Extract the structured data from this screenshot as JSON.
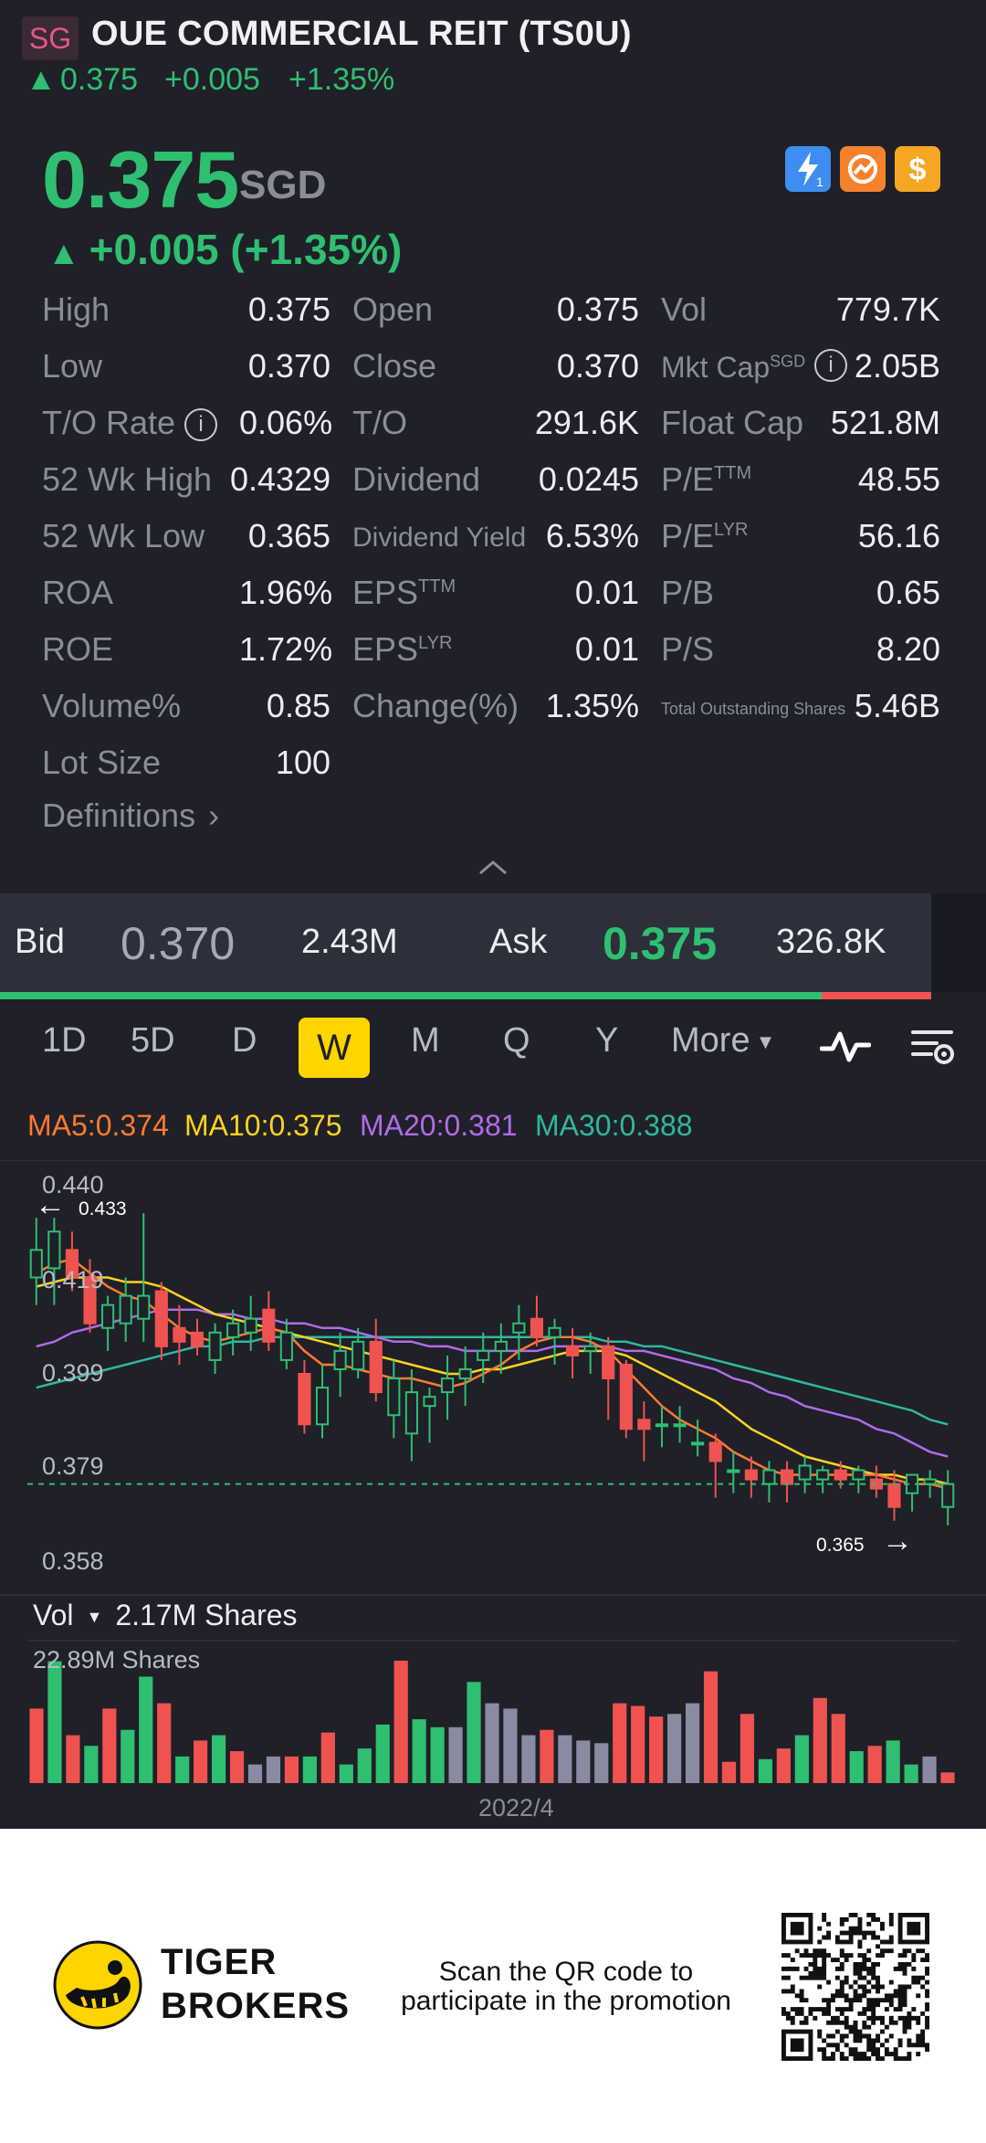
{
  "header": {
    "market_tag": "SG",
    "title": "OUE COMMERCIAL REIT (TS0U)",
    "last": "0.375",
    "change": "+0.005",
    "change_pct": "+1.35%"
  },
  "quote": {
    "price": "0.375",
    "currency": "SGD",
    "change_line": "+0.005 (+1.35%)"
  },
  "badges": [
    "lightning-badge-icon",
    "options-badge-icon",
    "dollar-badge-icon"
  ],
  "stats": {
    "col1": [
      {
        "label": "High",
        "value": "0.375"
      },
      {
        "label": "Low",
        "value": "0.370"
      },
      {
        "label": "T/O Rate",
        "value": "0.06%"
      },
      {
        "label": "52 Wk High",
        "value": "0.4329"
      },
      {
        "label": "52 Wk Low",
        "value": "0.365"
      },
      {
        "label": "ROA",
        "value": "1.96%"
      },
      {
        "label": "ROE",
        "value": "1.72%"
      },
      {
        "label": "Volume%",
        "value": "0.85"
      },
      {
        "label": "Lot Size",
        "value": "100"
      }
    ],
    "col2": [
      {
        "label": "Open",
        "value": "0.375"
      },
      {
        "label": "Close",
        "value": "0.370"
      },
      {
        "label": "T/O",
        "value": "291.6K"
      },
      {
        "label": "Dividend",
        "value": "0.0245"
      },
      {
        "label": "Dividend Yield",
        "value": "6.53%"
      },
      {
        "label": "EPS",
        "sup": "TTM",
        "value": "0.01"
      },
      {
        "label": "EPS",
        "sup": "LYR",
        "value": "0.01"
      },
      {
        "label": "Change(%)",
        "value": "1.35%"
      }
    ],
    "col3": [
      {
        "label": "Vol",
        "value": "779.7K"
      },
      {
        "label": "Mkt Cap",
        "sup": "SGD",
        "value": "2.05B"
      },
      {
        "label": "Float Cap",
        "value": "521.8M"
      },
      {
        "label": "P/E",
        "sup": "TTM",
        "value": "48.55"
      },
      {
        "label": "P/E",
        "sup": "LYR",
        "value": "56.16"
      },
      {
        "label": "P/B",
        "value": "0.65"
      },
      {
        "label": "P/S",
        "value": "8.20"
      },
      {
        "label": "Total Outstanding Shares",
        "value": "5.46B"
      }
    ],
    "definitions": "Definitions"
  },
  "orderbook": {
    "bid_label": "Bid",
    "bid_price": "0.370",
    "bid_size": "2.43M",
    "ask_label": "Ask",
    "ask_price": "0.375",
    "ask_size": "326.8K"
  },
  "tabs": [
    "1D",
    "5D",
    "D",
    "W",
    "M",
    "Q",
    "Y",
    "More"
  ],
  "active_tab": "W",
  "ma": {
    "ma5": "MA5:0.374",
    "ma10": "MA10:0.375",
    "ma20": "MA20:0.381",
    "ma30": "MA30:0.388",
    "colors": {
      "ma5": "#ff7a2f",
      "ma10": "#ffd21f",
      "ma20": "#b06ce8",
      "ma30": "#2fb8a0"
    }
  },
  "colors": {
    "up": "#2fbf71",
    "down": "#ef5350",
    "neutral": "#8a8ba3"
  },
  "chart_data": {
    "type": "candlestick",
    "y_ticks": [
      "0.440",
      "0.419",
      "0.399",
      "0.379",
      "0.358"
    ],
    "ylim": [
      0.358,
      0.44
    ],
    "high_marker": "0.433",
    "low_marker": "0.365",
    "last_price_line": 0.375,
    "candles": [
      {
        "o": 0.42,
        "h": 0.433,
        "l": 0.414,
        "c": 0.426
      },
      {
        "o": 0.422,
        "h": 0.433,
        "l": 0.414,
        "c": 0.43
      },
      {
        "o": 0.426,
        "h": 0.43,
        "l": 0.417,
        "c": 0.42
      },
      {
        "o": 0.42,
        "h": 0.424,
        "l": 0.408,
        "c": 0.41
      },
      {
        "o": 0.409,
        "h": 0.416,
        "l": 0.404,
        "c": 0.414
      },
      {
        "o": 0.41,
        "h": 0.42,
        "l": 0.406,
        "c": 0.416
      },
      {
        "o": 0.411,
        "h": 0.434,
        "l": 0.406,
        "c": 0.416
      },
      {
        "o": 0.417,
        "h": 0.419,
        "l": 0.402,
        "c": 0.405
      },
      {
        "o": 0.409,
        "h": 0.414,
        "l": 0.401,
        "c": 0.406
      },
      {
        "o": 0.408,
        "h": 0.411,
        "l": 0.403,
        "c": 0.405
      },
      {
        "o": 0.402,
        "h": 0.41,
        "l": 0.399,
        "c": 0.408
      },
      {
        "o": 0.407,
        "h": 0.413,
        "l": 0.403,
        "c": 0.41
      },
      {
        "o": 0.408,
        "h": 0.416,
        "l": 0.404,
        "c": 0.411
      },
      {
        "o": 0.413,
        "h": 0.417,
        "l": 0.404,
        "c": 0.406
      },
      {
        "o": 0.402,
        "h": 0.411,
        "l": 0.4,
        "c": 0.408
      },
      {
        "o": 0.399,
        "h": 0.402,
        "l": 0.386,
        "c": 0.388
      },
      {
        "o": 0.388,
        "h": 0.401,
        "l": 0.385,
        "c": 0.396
      },
      {
        "o": 0.4,
        "h": 0.408,
        "l": 0.394,
        "c": 0.404
      },
      {
        "o": 0.4,
        "h": 0.409,
        "l": 0.398,
        "c": 0.406
      },
      {
        "o": 0.406,
        "h": 0.411,
        "l": 0.393,
        "c": 0.395
      },
      {
        "o": 0.39,
        "h": 0.402,
        "l": 0.385,
        "c": 0.398
      },
      {
        "o": 0.386,
        "h": 0.4,
        "l": 0.38,
        "c": 0.395
      },
      {
        "o": 0.392,
        "h": 0.396,
        "l": 0.384,
        "c": 0.394
      },
      {
        "o": 0.395,
        "h": 0.403,
        "l": 0.389,
        "c": 0.398
      },
      {
        "o": 0.398,
        "h": 0.405,
        "l": 0.392,
        "c": 0.4
      },
      {
        "o": 0.402,
        "h": 0.408,
        "l": 0.397,
        "c": 0.404
      },
      {
        "o": 0.404,
        "h": 0.41,
        "l": 0.399,
        "c": 0.406
      },
      {
        "o": 0.408,
        "h": 0.414,
        "l": 0.402,
        "c": 0.41
      },
      {
        "o": 0.411,
        "h": 0.416,
        "l": 0.405,
        "c": 0.407
      },
      {
        "o": 0.407,
        "h": 0.411,
        "l": 0.401,
        "c": 0.409
      },
      {
        "o": 0.405,
        "h": 0.409,
        "l": 0.398,
        "c": 0.403
      },
      {
        "o": 0.404,
        "h": 0.408,
        "l": 0.399,
        "c": 0.405
      },
      {
        "o": 0.405,
        "h": 0.407,
        "l": 0.389,
        "c": 0.398
      },
      {
        "o": 0.401,
        "h": 0.402,
        "l": 0.385,
        "c": 0.387
      },
      {
        "o": 0.389,
        "h": 0.393,
        "l": 0.38,
        "c": 0.387
      },
      {
        "o": 0.388,
        "h": 0.392,
        "l": 0.383,
        "c": 0.388
      },
      {
        "o": 0.388,
        "h": 0.392,
        "l": 0.384,
        "c": 0.388
      },
      {
        "o": 0.384,
        "h": 0.389,
        "l": 0.381,
        "c": 0.384
      },
      {
        "o": 0.384,
        "h": 0.386,
        "l": 0.372,
        "c": 0.38
      },
      {
        "o": 0.378,
        "h": 0.382,
        "l": 0.373,
        "c": 0.378
      },
      {
        "o": 0.378,
        "h": 0.381,
        "l": 0.372,
        "c": 0.376
      },
      {
        "o": 0.375,
        "h": 0.38,
        "l": 0.371,
        "c": 0.378
      },
      {
        "o": 0.378,
        "h": 0.38,
        "l": 0.371,
        "c": 0.375
      },
      {
        "o": 0.376,
        "h": 0.381,
        "l": 0.373,
        "c": 0.379
      },
      {
        "o": 0.376,
        "h": 0.379,
        "l": 0.373,
        "c": 0.378
      },
      {
        "o": 0.378,
        "h": 0.38,
        "l": 0.374,
        "c": 0.376
      },
      {
        "o": 0.376,
        "h": 0.379,
        "l": 0.373,
        "c": 0.378
      },
      {
        "o": 0.376,
        "h": 0.379,
        "l": 0.372,
        "c": 0.374
      },
      {
        "o": 0.375,
        "h": 0.378,
        "l": 0.367,
        "c": 0.37
      },
      {
        "o": 0.373,
        "h": 0.377,
        "l": 0.369,
        "c": 0.377
      },
      {
        "o": 0.375,
        "h": 0.378,
        "l": 0.372,
        "c": 0.376
      },
      {
        "o": 0.37,
        "h": 0.378,
        "l": 0.366,
        "c": 0.375
      }
    ],
    "ma5": [
      0.421,
      0.423,
      0.424,
      0.421,
      0.418,
      0.416,
      0.415,
      0.412,
      0.409,
      0.407,
      0.406,
      0.407,
      0.408,
      0.409,
      0.408,
      0.404,
      0.401,
      0.401,
      0.4,
      0.399,
      0.398,
      0.398,
      0.397,
      0.396,
      0.397,
      0.399,
      0.401,
      0.404,
      0.406,
      0.407,
      0.407,
      0.406,
      0.404,
      0.4,
      0.396,
      0.392,
      0.389,
      0.387,
      0.385,
      0.382,
      0.38,
      0.378,
      0.377,
      0.377,
      0.377,
      0.377,
      0.377,
      0.377,
      0.376,
      0.375,
      0.375,
      0.374
    ],
    "ma10": [
      0.418,
      0.419,
      0.42,
      0.42,
      0.42,
      0.419,
      0.419,
      0.418,
      0.416,
      0.414,
      0.412,
      0.411,
      0.41,
      0.409,
      0.408,
      0.407,
      0.406,
      0.405,
      0.404,
      0.403,
      0.402,
      0.401,
      0.4,
      0.399,
      0.399,
      0.4,
      0.4,
      0.401,
      0.402,
      0.403,
      0.404,
      0.404,
      0.404,
      0.403,
      0.401,
      0.399,
      0.397,
      0.395,
      0.393,
      0.39,
      0.387,
      0.385,
      0.383,
      0.381,
      0.38,
      0.379,
      0.378,
      0.377,
      0.377,
      0.376,
      0.376,
      0.375
    ],
    "ma20": [
      0.405,
      0.406,
      0.408,
      0.409,
      0.41,
      0.411,
      0.412,
      0.413,
      0.413,
      0.413,
      0.412,
      0.412,
      0.411,
      0.411,
      0.41,
      0.41,
      0.409,
      0.409,
      0.408,
      0.407,
      0.406,
      0.406,
      0.405,
      0.405,
      0.404,
      0.404,
      0.404,
      0.404,
      0.404,
      0.405,
      0.405,
      0.405,
      0.405,
      0.404,
      0.404,
      0.403,
      0.402,
      0.401,
      0.4,
      0.398,
      0.397,
      0.395,
      0.394,
      0.392,
      0.391,
      0.39,
      0.389,
      0.387,
      0.386,
      0.384,
      0.382,
      0.381
    ],
    "ma30": [
      0.396,
      0.397,
      0.398,
      0.399,
      0.4,
      0.401,
      0.402,
      0.403,
      0.404,
      0.405,
      0.405,
      0.406,
      0.406,
      0.407,
      0.407,
      0.407,
      0.407,
      0.407,
      0.407,
      0.407,
      0.407,
      0.407,
      0.407,
      0.407,
      0.407,
      0.407,
      0.407,
      0.407,
      0.407,
      0.407,
      0.407,
      0.407,
      0.406,
      0.406,
      0.405,
      0.405,
      0.404,
      0.403,
      0.402,
      0.401,
      0.4,
      0.399,
      0.398,
      0.397,
      0.396,
      0.395,
      0.394,
      0.393,
      0.392,
      0.391,
      0.389,
      0.388
    ],
    "volume_label": "Vol",
    "volume_value": "2.17M Shares",
    "volume_max_label": "22.89M Shares",
    "volume": [
      {
        "v": 14,
        "d": "down"
      },
      {
        "v": 22.9,
        "d": "up"
      },
      {
        "v": 9,
        "d": "down"
      },
      {
        "v": 7,
        "d": "up"
      },
      {
        "v": 14,
        "d": "down"
      },
      {
        "v": 10,
        "d": "up"
      },
      {
        "v": 20,
        "d": "up"
      },
      {
        "v": 15,
        "d": "down"
      },
      {
        "v": 5,
        "d": "up"
      },
      {
        "v": 8,
        "d": "down"
      },
      {
        "v": 9,
        "d": "up"
      },
      {
        "v": 6,
        "d": "down"
      },
      {
        "v": 3.5,
        "d": "flat"
      },
      {
        "v": 5,
        "d": "flat"
      },
      {
        "v": 5,
        "d": "down"
      },
      {
        "v": 5,
        "d": "up"
      },
      {
        "v": 9.5,
        "d": "down"
      },
      {
        "v": 3.5,
        "d": "up"
      },
      {
        "v": 6.5,
        "d": "up"
      },
      {
        "v": 11,
        "d": "up"
      },
      {
        "v": 23,
        "d": "down"
      },
      {
        "v": 12,
        "d": "up"
      },
      {
        "v": 10.5,
        "d": "up"
      },
      {
        "v": 10.5,
        "d": "flat"
      },
      {
        "v": 19,
        "d": "up"
      },
      {
        "v": 15,
        "d": "flat"
      },
      {
        "v": 14,
        "d": "flat"
      },
      {
        "v": 9,
        "d": "flat"
      },
      {
        "v": 10,
        "d": "down"
      },
      {
        "v": 9,
        "d": "flat"
      },
      {
        "v": 8,
        "d": "flat"
      },
      {
        "v": 7.5,
        "d": "flat"
      },
      {
        "v": 15,
        "d": "down"
      },
      {
        "v": 14.5,
        "d": "down"
      },
      {
        "v": 12.5,
        "d": "down"
      },
      {
        "v": 13,
        "d": "flat"
      },
      {
        "v": 15,
        "d": "flat"
      },
      {
        "v": 21,
        "d": "down"
      },
      {
        "v": 4,
        "d": "down"
      },
      {
        "v": 13,
        "d": "down"
      },
      {
        "v": 4.5,
        "d": "up"
      },
      {
        "v": 6.5,
        "d": "down"
      },
      {
        "v": 9,
        "d": "up"
      },
      {
        "v": 16,
        "d": "down"
      },
      {
        "v": 13,
        "d": "down"
      },
      {
        "v": 6,
        "d": "up"
      },
      {
        "v": 7,
        "d": "down"
      },
      {
        "v": 8,
        "d": "up"
      },
      {
        "v": 3.5,
        "d": "up"
      },
      {
        "v": 5,
        "d": "flat"
      },
      {
        "v": 2,
        "d": "down"
      }
    ],
    "x_label": "2022/4"
  },
  "footer": {
    "brand_line1": "TIGER",
    "brand_line2": "BROKERS",
    "promo_line1": "Scan the QR code to",
    "promo_line2": "participate in the promotion"
  }
}
